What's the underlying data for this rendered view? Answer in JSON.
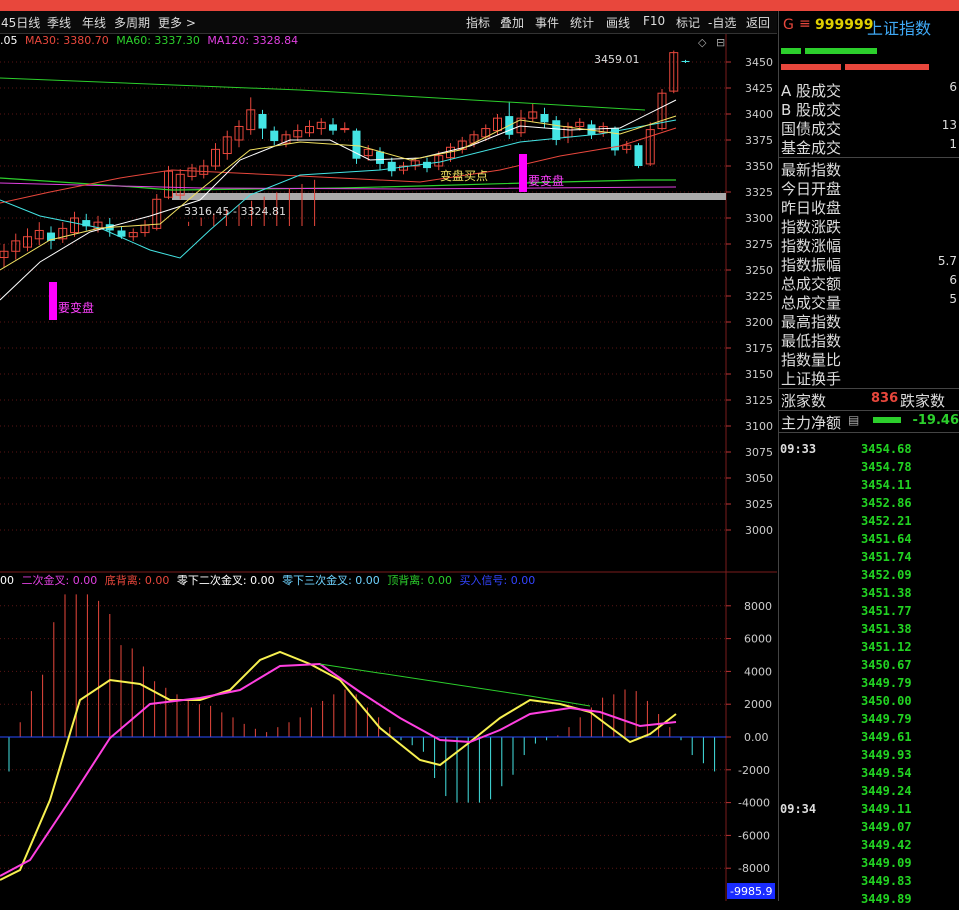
{
  "toolbar": {
    "left": [
      "45日线",
      "季线",
      "年线",
      "多周期",
      "更多 >"
    ],
    "right": [
      "指标",
      "叠加",
      "事件",
      "统计",
      "画线",
      "F10",
      "标记",
      "-自选",
      "返回"
    ]
  },
  "ma_legend": [
    {
      "label": ".05",
      "color": "#ffffff"
    },
    {
      "label": "MA30: 3380.70",
      "color": "#e8473c"
    },
    {
      "label": "MA60: 3337.30",
      "color": "#2ccf2c"
    },
    {
      "label": "MA120: 3328.84",
      "color": "#e040e0"
    }
  ],
  "indicator_legend": [
    {
      "label": "00",
      "color": "#ffffff"
    },
    {
      "label": "二次金叉: 0.00",
      "color": "#e040e0"
    },
    {
      "label": "底背离: 0.00",
      "color": "#e8473c"
    },
    {
      "label": "零下二次金叉: 0.00",
      "color": "#ffffff"
    },
    {
      "label": "零下三次金叉: 0.00",
      "color": "#6fd3ff"
    },
    {
      "label": "顶背离: 0.00",
      "color": "#2ccf2c"
    },
    {
      "label": "买入信号: 0.00",
      "color": "#3344ff"
    }
  ],
  "price_axis": [
    "3450",
    "3425",
    "3400",
    "3375",
    "3350",
    "3325",
    "3300",
    "3275",
    "3250",
    "3225",
    "3200",
    "3175",
    "3150",
    "3125",
    "3100",
    "3075",
    "3050",
    "3025",
    "3000"
  ],
  "indicator_axis": [
    "8000",
    "6000",
    "4000",
    "2000",
    "0.00",
    "-2000",
    "-4000",
    "-6000",
    "-8000"
  ],
  "indicator_current": "-9985.9",
  "annotations": {
    "high_price": "3459.01",
    "range_label": "3316.45 - 3324.81",
    "signal_mid": "变盘买点",
    "signal_left": "要变盘",
    "signal_right": "要变盘"
  },
  "right_panel": {
    "g_label": "G",
    "code": "999999",
    "name": "上证指数",
    "rows": [
      {
        "label": "A 股成交",
        "value": "6"
      },
      {
        "label": "B 股成交",
        "value": ""
      },
      {
        "label": "国债成交",
        "value": "13"
      },
      {
        "label": "基金成交",
        "value": "1"
      },
      {
        "label": "最新指数",
        "value": ""
      },
      {
        "label": "今日开盘",
        "value": ""
      },
      {
        "label": "昨日收盘",
        "value": ""
      },
      {
        "label": "指数涨跌",
        "value": ""
      },
      {
        "label": "指数涨幅",
        "value": ""
      },
      {
        "label": "指数振幅",
        "value": "5.7"
      },
      {
        "label": "总成交额",
        "value": "6"
      },
      {
        "label": "总成交量",
        "value": "5"
      },
      {
        "label": "最高指数",
        "value": ""
      },
      {
        "label": "最低指数",
        "value": ""
      },
      {
        "label": "指数量比",
        "value": ""
      },
      {
        "label": "上证换手",
        "value": ""
      }
    ],
    "up_label": "涨家数",
    "up_value": "836",
    "down_label": "跌家数",
    "main_label": "主力净额",
    "main_value": "-19.46",
    "ticks": [
      {
        "time": "09:33",
        "price": "3454.68"
      },
      {
        "time": "",
        "price": "3454.78"
      },
      {
        "time": "",
        "price": "3454.11"
      },
      {
        "time": "",
        "price": "3452.86"
      },
      {
        "time": "",
        "price": "3452.21"
      },
      {
        "time": "",
        "price": "3451.64"
      },
      {
        "time": "",
        "price": "3451.74"
      },
      {
        "time": "",
        "price": "3452.09"
      },
      {
        "time": "",
        "price": "3451.38"
      },
      {
        "time": "",
        "price": "3451.77"
      },
      {
        "time": "",
        "price": "3451.38"
      },
      {
        "time": "",
        "price": "3451.12"
      },
      {
        "time": "",
        "price": "3450.67"
      },
      {
        "time": "",
        "price": "3449.79"
      },
      {
        "time": "",
        "price": "3450.00"
      },
      {
        "time": "",
        "price": "3449.79"
      },
      {
        "time": "",
        "price": "3449.61"
      },
      {
        "time": "",
        "price": "3449.93"
      },
      {
        "time": "",
        "price": "3449.54"
      },
      {
        "time": "",
        "price": "3449.24"
      },
      {
        "time": "09:34",
        "price": "3449.11"
      },
      {
        "time": "",
        "price": "3449.07"
      },
      {
        "time": "",
        "price": "3449.42"
      },
      {
        "time": "",
        "price": "3449.09"
      },
      {
        "time": "",
        "price": "3449.83"
      },
      {
        "time": "",
        "price": "3449.89"
      }
    ]
  },
  "colors": {
    "up": "#e8473c",
    "down": "#44e4e4",
    "accent": "#e8473c"
  }
}
